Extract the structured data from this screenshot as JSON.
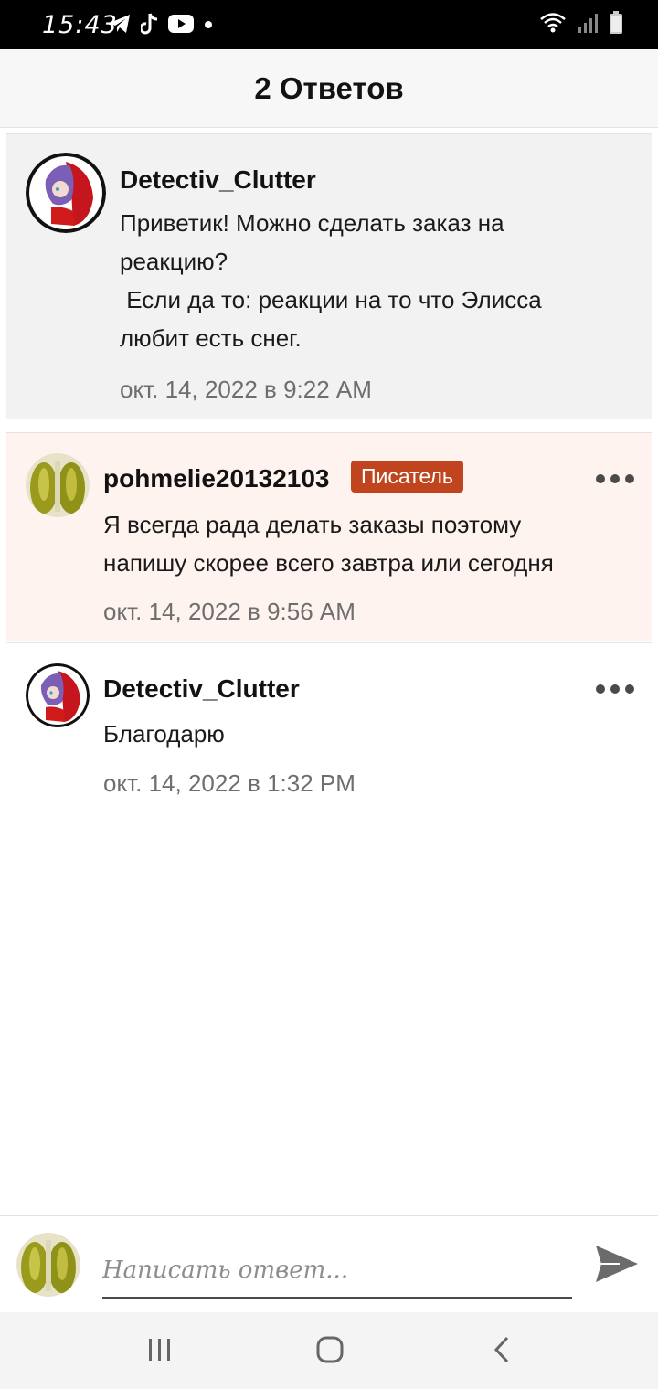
{
  "status_bar": {
    "time": "15:43",
    "left_icons": [
      "telegram-icon",
      "tiktok-icon",
      "youtube-icon",
      "dot-icon"
    ],
    "right_icons": [
      "wifi-icon",
      "signal-icon",
      "battery-icon"
    ]
  },
  "header": {
    "title": "2 Ответов"
  },
  "comments": [
    {
      "author": "Detectiv_Clutter",
      "text": "Приветик! Можно сделать заказ на\nреакцию?\n Если да то: реакции на то что Элисса\nлюбит есть снег.",
      "time": "окт. 14, 2022 в 9:22 AM",
      "avatar": "red-anime-avatar"
    },
    {
      "author": "pohmelie20132103",
      "badge": "Писатель",
      "text": "Я всегда рада делать заказы поэтому\nнапишу скорее всего завтра или сегодня",
      "time": "окт. 14, 2022 в 9:56 AM",
      "avatar": "pickles-avatar",
      "colors": {
        "highlight_bg": "#fff3ef",
        "badge_bg": "#c0451e"
      }
    },
    {
      "author": "Detectiv_Clutter",
      "text": "Благодарю",
      "time": "окт. 14, 2022 в 1:32 PM",
      "avatar": "red-anime-avatar"
    }
  ],
  "reply": {
    "placeholder": "Написать ответ...",
    "value": "",
    "send_icon": "send-icon"
  },
  "nav": {
    "icons": [
      "recent-apps-icon",
      "home-icon",
      "back-icon"
    ]
  }
}
